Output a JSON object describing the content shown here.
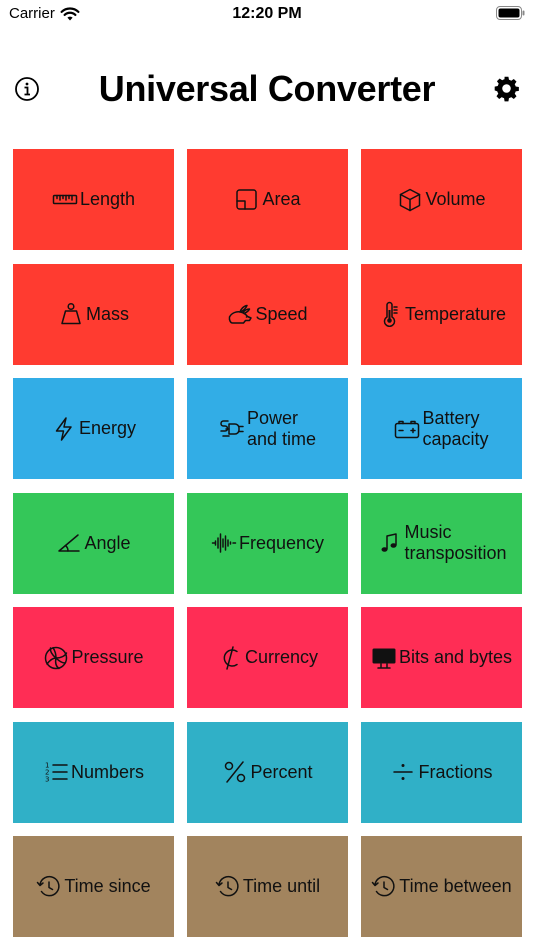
{
  "status_bar": {
    "carrier": "Carrier",
    "time": "12:20 PM"
  },
  "nav": {
    "title": "Universal Converter",
    "info_icon": "info-circle-icon",
    "settings_icon": "gear-icon"
  },
  "colors": {
    "red": "#FF3B30",
    "blue": "#32ADE6",
    "green": "#34C759",
    "pink": "#FF2D55",
    "teal": "#30B0C7",
    "brown": "#A2845E"
  },
  "tiles": [
    {
      "label": "Length",
      "icon": "ruler-icon",
      "color": "#FF3B30"
    },
    {
      "label": "Area",
      "icon": "area-square-icon",
      "color": "#FF3B30"
    },
    {
      "label": "Volume",
      "icon": "cube-icon",
      "color": "#FF3B30"
    },
    {
      "label": "Mass",
      "icon": "scalemass-icon",
      "color": "#FF3B30"
    },
    {
      "label": "Speed",
      "icon": "hare-icon",
      "color": "#FF3B30"
    },
    {
      "label": "Temperature",
      "icon": "thermometer-icon",
      "color": "#FF3B30"
    },
    {
      "label": "Energy",
      "icon": "bolt-icon",
      "color": "#32ADE6"
    },
    {
      "label": "Power\nand time",
      "icon": "power-plug-icon",
      "color": "#32ADE6"
    },
    {
      "label": "Battery\ncapacity",
      "icon": "car-battery-icon",
      "color": "#32ADE6"
    },
    {
      "label": "Angle",
      "icon": "angle-icon",
      "color": "#34C759"
    },
    {
      "label": "Frequency",
      "icon": "waveform-icon",
      "color": "#34C759"
    },
    {
      "label": "Music\ntransposition",
      "icon": "music-note-icon",
      "color": "#34C759"
    },
    {
      "label": "Pressure",
      "icon": "volleyball-icon",
      "color": "#FF2D55"
    },
    {
      "label": "Currency",
      "icon": "cedi-sign-icon",
      "color": "#FF2D55"
    },
    {
      "label": "Bits and bytes",
      "icon": "display-icon",
      "color": "#FF2D55"
    },
    {
      "label": "Numbers",
      "icon": "numbered-list-icon",
      "color": "#30B0C7"
    },
    {
      "label": "Percent",
      "icon": "percent-icon",
      "color": "#30B0C7"
    },
    {
      "label": "Fractions",
      "icon": "divide-icon",
      "color": "#30B0C7"
    },
    {
      "label": "Time since",
      "icon": "clock-arrow-icon",
      "color": "#A2845E"
    },
    {
      "label": "Time until",
      "icon": "clock-arrow-icon",
      "color": "#A2845E"
    },
    {
      "label": "Time between",
      "icon": "clock-arrow-icon",
      "color": "#A2845E"
    }
  ]
}
